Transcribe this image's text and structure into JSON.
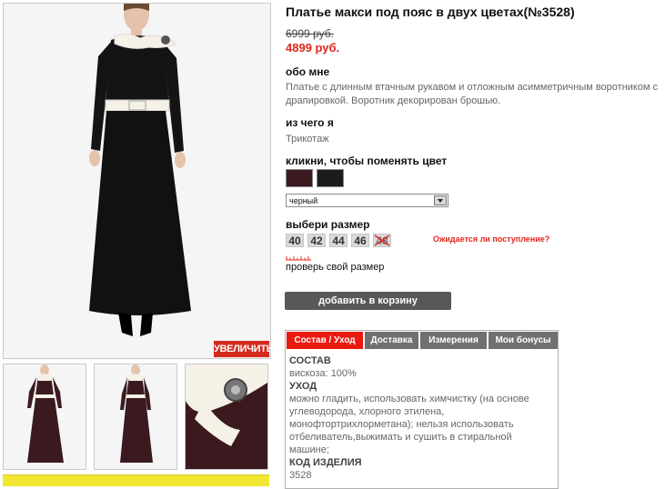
{
  "product": {
    "title": "Платье макси под пояс в двух цветах(№3528)",
    "old_price": "6999 руб.",
    "new_price": "4899 руб."
  },
  "gallery": {
    "zoom_label": "УВЕЛИЧИТЬ"
  },
  "about": {
    "heading": "обо мне",
    "text": "Платье с длинным втачным рукавом и отложным асимметричным воротником с драпировкой. Воротник декорирован брошью."
  },
  "material": {
    "heading": "из чего я",
    "text": "Трикотаж"
  },
  "color": {
    "heading": "кликни, чтобы поменять цвет",
    "swatches": [
      "#3b1a1f",
      "#1c1c1c"
    ],
    "selected": "черный"
  },
  "size": {
    "heading": "выбери размер",
    "options": [
      "40",
      "42",
      "44",
      "46",
      "48"
    ],
    "waiting_label": "Ожидается ли поступление?",
    "check_label": "проверь свой размер"
  },
  "cart": {
    "add_label": "добавить в корзину"
  },
  "tabs": {
    "items": [
      "Состав / Уход",
      "Доставка",
      "Измерения",
      "Мои бонусы"
    ],
    "content": {
      "h1": "СОСТАВ",
      "t1": "вискоза: 100%",
      "h2": "УХОД",
      "t2": "можно гладить, использовать химчистку (на основе углеводорода, хлорного этилена, монофтортрихлорметана); нельзя использовать отбеливатель,выжимать и сушить в стиральной машине;",
      "h3": "КОД ИЗДЕЛИЯ",
      "t3": "3528"
    }
  },
  "colors": {
    "accent_red": "#e0261b",
    "tab_active": "#ea1a10",
    "button_gray": "#585858"
  }
}
